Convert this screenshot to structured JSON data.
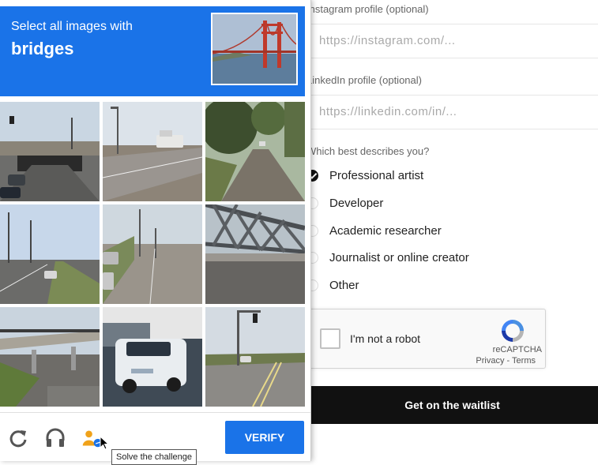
{
  "form": {
    "instagram": {
      "label": "Instagram profile (optional)",
      "placeholder": "https://instagram.com/..."
    },
    "linkedin": {
      "label": "LinkedIn profile (optional)",
      "placeholder": "https://linkedin.com/in/..."
    },
    "describes": {
      "question": "Which best describes you?",
      "options": [
        {
          "label": "Professional artist",
          "checked": true
        },
        {
          "label": "Developer",
          "checked": false
        },
        {
          "label": "Academic researcher",
          "checked": false
        },
        {
          "label": "Journalist or online creator",
          "checked": false
        },
        {
          "label": "Other",
          "checked": false
        }
      ]
    },
    "recaptcha": {
      "checkbox_label": "I'm not a robot",
      "brand": "reCAPTCHA",
      "links": "Privacy - Terms"
    },
    "submit_label": "Get on the waitlist"
  },
  "challenge": {
    "instruction": "Select all images with",
    "target": "bridges",
    "header_color": "#1a73e8",
    "tiles": [
      {
        "icon": "street-overpass-image"
      },
      {
        "icon": "street-truck-image"
      },
      {
        "icon": "tree-road-image"
      },
      {
        "icon": "road-poles-image"
      },
      {
        "icon": "road-cars-image"
      },
      {
        "icon": "steel-bridge-image"
      },
      {
        "icon": "overpass-image"
      },
      {
        "icon": "white-suv-image"
      },
      {
        "icon": "intersection-image"
      }
    ],
    "footer": {
      "reload_icon": "reload-icon",
      "audio_icon": "headphones-icon",
      "info_icon": "person-help-icon",
      "verify_label": "VERIFY",
      "tooltip": "Solve the challenge"
    }
  }
}
